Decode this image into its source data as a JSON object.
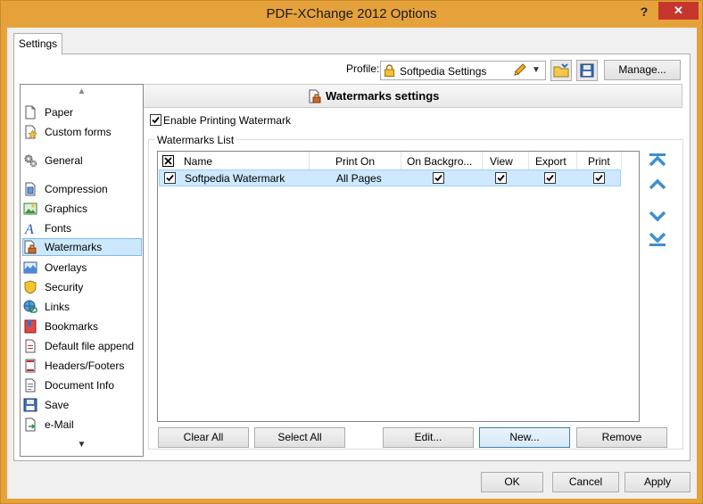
{
  "window": {
    "title": "PDF-XChange 2012 Options",
    "help_glyph": "?",
    "close_glyph": "✕"
  },
  "tabs": [
    {
      "label": "Settings"
    }
  ],
  "profile": {
    "label": "Profile:",
    "value": "Softpedia Settings",
    "manage_label": "Manage..."
  },
  "sidebar": {
    "items": [
      {
        "label": "Paper",
        "icon": "paper-icon"
      },
      {
        "label": "Custom forms",
        "icon": "custom-forms-icon"
      },
      {
        "label": "General",
        "icon": "gears-icon"
      },
      {
        "label": "Compression",
        "icon": "compression-icon"
      },
      {
        "label": "Graphics",
        "icon": "graphics-icon"
      },
      {
        "label": "Fonts",
        "icon": "font-icon"
      },
      {
        "label": "Watermarks",
        "icon": "watermark-icon",
        "selected": true
      },
      {
        "label": "Overlays",
        "icon": "overlays-icon"
      },
      {
        "label": "Security",
        "icon": "shield-icon"
      },
      {
        "label": "Links",
        "icon": "link-icon"
      },
      {
        "label": "Bookmarks",
        "icon": "bookmark-icon"
      },
      {
        "label": "Default file append",
        "icon": "file-append-icon"
      },
      {
        "label": "Headers/Footers",
        "icon": "headers-footers-icon"
      },
      {
        "label": "Document Info",
        "icon": "document-info-icon"
      },
      {
        "label": "Save",
        "icon": "save-icon"
      },
      {
        "label": "e-Mail",
        "icon": "email-icon"
      }
    ]
  },
  "panel": {
    "title": "Watermarks settings",
    "enable_label": "Enable Printing Watermark",
    "enable_checked": true,
    "list_title": "Watermarks List",
    "columns": [
      "Name",
      "Print On",
      "On Backgro...",
      "View",
      "Export",
      "Print"
    ],
    "rows": [
      {
        "checked": true,
        "name": "Softpedia Watermark",
        "print_on": "All Pages",
        "on_background": true,
        "view": true,
        "export": true,
        "print": true
      }
    ],
    "buttons": {
      "clear_all": "Clear All",
      "select_all": "Select All",
      "edit": "Edit...",
      "new": "New...",
      "remove": "Remove"
    }
  },
  "footer": {
    "ok": "OK",
    "cancel": "Cancel",
    "apply": "Apply"
  },
  "colors": {
    "titlebar": "#e6a23a",
    "close": "#c7362d",
    "selection": "#cde8ff",
    "accent_blue": "#3d8fd1"
  }
}
